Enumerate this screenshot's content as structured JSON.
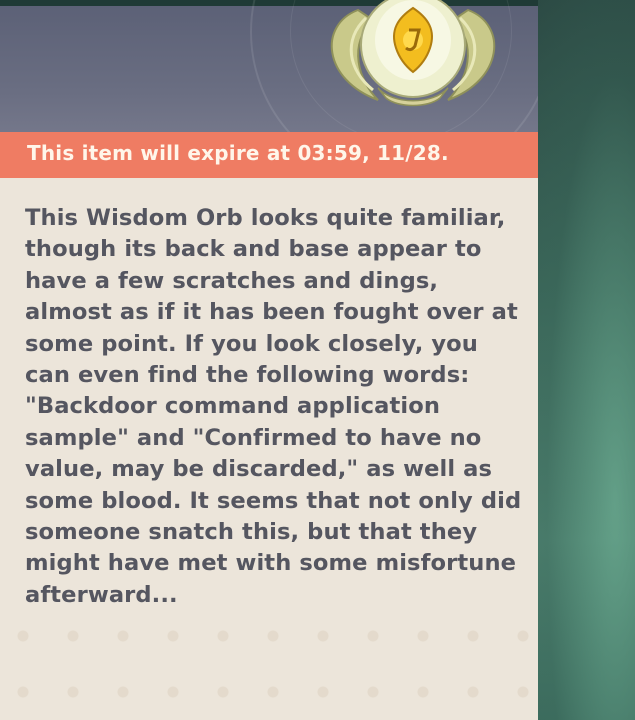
{
  "item": {
    "icon": "wisdom-orb-icon",
    "expiry_text": "This item will expire at 03:59, 11/28.",
    "description": "This Wisdom Orb looks quite familiar, though its back and base appear to have a few scratches and dings, almost as if it has been fought over at some point. If you look closely, you can even find the following words: \"Backdoor command application sample\" and \"Confirmed to have no value, may be discarded,\" as well as some blood. It seems that not only did someone snatch this, but that they might have met with some misfortune afterward..."
  },
  "colors": {
    "expiry_bar": "#ef7c63",
    "panel_bg": "#ece5da",
    "header_bg": "#6a6e82",
    "text": "#555660"
  }
}
